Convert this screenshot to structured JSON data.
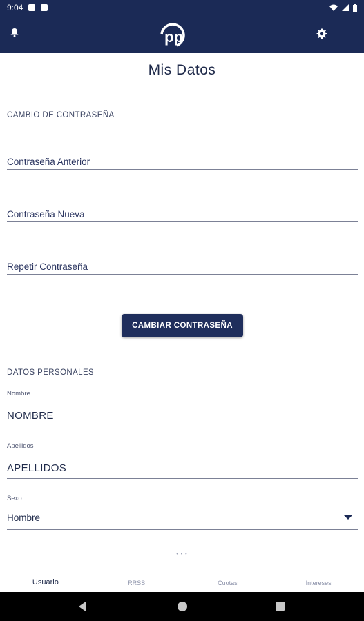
{
  "status_bar": {
    "time": "9:04",
    "icons": [
      "wifi-icon",
      "signal-icon",
      "battery-icon"
    ]
  },
  "app_bar": {
    "icons": [
      "bell-icon",
      "pp-logo",
      "gear-icon"
    ],
    "color": "#1b2a56"
  },
  "page": {
    "title": "Mis Datos"
  },
  "password_section": {
    "heading": "CAMBIO DE CONTRASEÑA",
    "fields": [
      {
        "placeholder": "Contraseña Anterior",
        "value": ""
      },
      {
        "placeholder": "Contraseña Nueva",
        "value": ""
      },
      {
        "placeholder": "Repetir Contraseña",
        "value": ""
      }
    ],
    "button_label": "CAMBIAR CONTRASEÑA"
  },
  "personal_section": {
    "heading": "DATOS PERSONALES",
    "nombre": {
      "label": "Nombre",
      "value": "NOMBRE"
    },
    "apellidos": {
      "label": "Apellidos",
      "value": "APELLIDOS"
    },
    "sexo": {
      "label": "Sexo",
      "value": "Hombre"
    }
  },
  "page_indicator": "• • •",
  "tabs": [
    {
      "label": "Usuario",
      "active": true
    },
    {
      "label": "RRSS",
      "active": false
    },
    {
      "label": "Cuotas",
      "active": false
    },
    {
      "label": "Intereses",
      "active": false
    }
  ]
}
